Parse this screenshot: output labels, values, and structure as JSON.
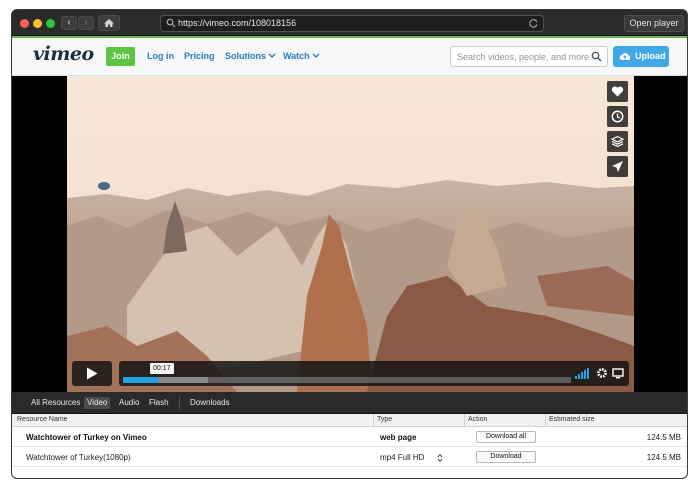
{
  "browser": {
    "url": "https://vimeo.com/108018156",
    "open_player_label": "Open player"
  },
  "vimeo": {
    "logo": "vimeo",
    "join_label": "Join",
    "nav": [
      "Log in",
      "Pricing",
      "Solutions",
      "Watch"
    ],
    "search_placeholder": "Search videos, people, and more",
    "upload_label": "Upload"
  },
  "player": {
    "time_tooltip": "00:17",
    "played_fraction": 0.079,
    "buffered_fraction": 0.19,
    "side_icons": [
      "heart-icon",
      "clock-icon",
      "layers-icon",
      "send-icon"
    ]
  },
  "resources": {
    "tabs": [
      "All Resources",
      "Video",
      "Audio",
      "Flash",
      "Downloads"
    ],
    "active_tab": "Video",
    "columns": [
      "Resource Name",
      "Type",
      "Action",
      "Estimated size"
    ],
    "rows": [
      {
        "name": "Watchtower of Turkey on Vimeo",
        "type": "web page",
        "action": "Download all",
        "size": "124.5 MB"
      },
      {
        "name": "Watchtower of Turkey(1080p)",
        "type": "mp4 Full HD",
        "action": "Download",
        "size": "124.5 MB"
      }
    ]
  },
  "colors": {
    "vimeo_blue": "#40a8e6",
    "join_green": "#5dc540",
    "progress": "#1da4e2"
  }
}
